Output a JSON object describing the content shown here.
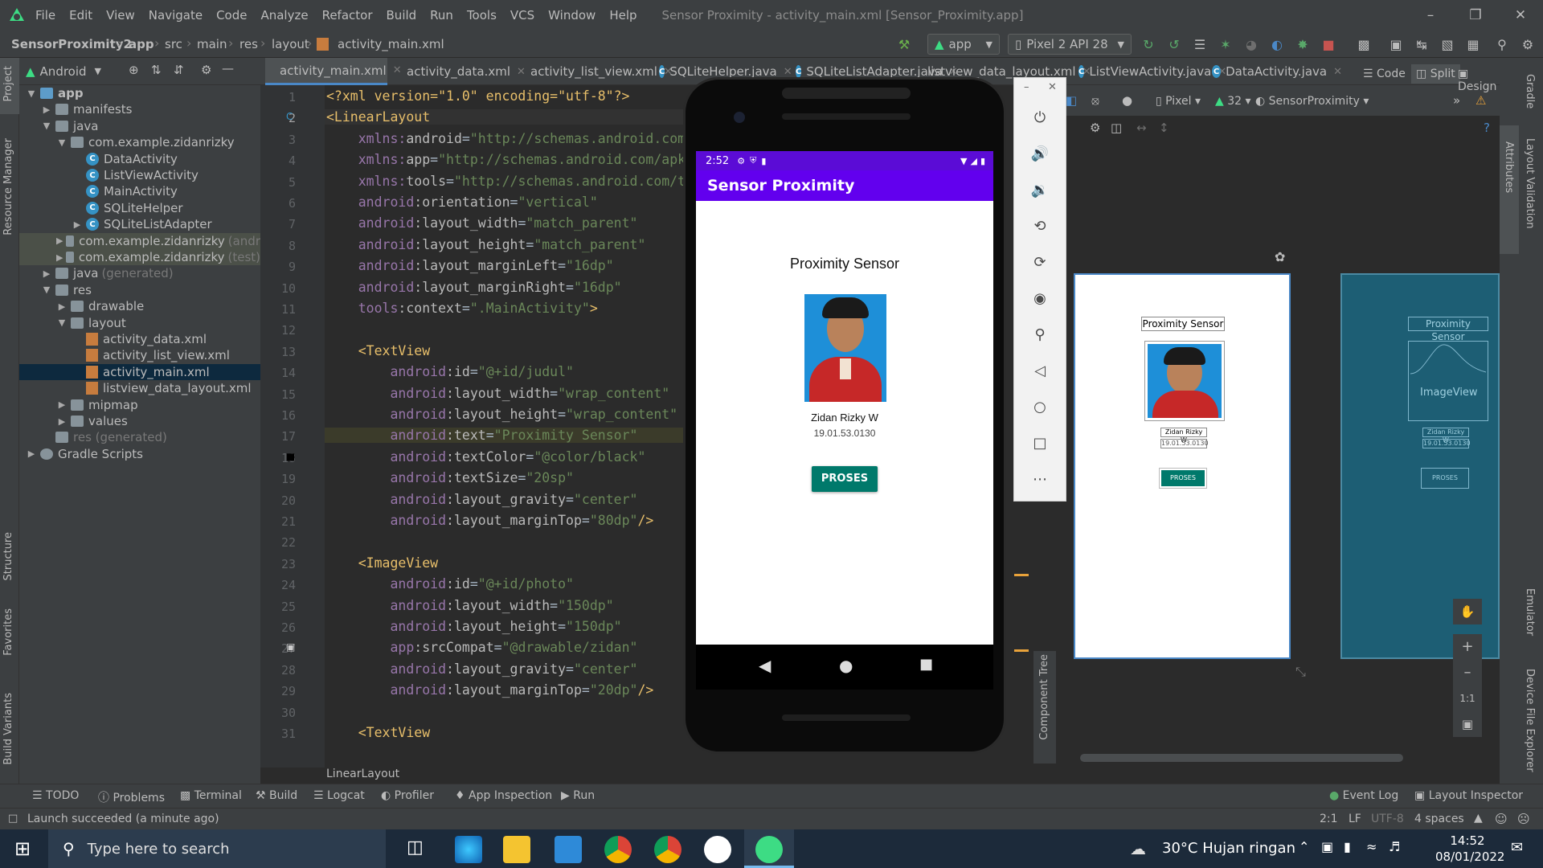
{
  "menu": {
    "items": [
      "File",
      "Edit",
      "View",
      "Navigate",
      "Code",
      "Analyze",
      "Refactor",
      "Build",
      "Run",
      "Tools",
      "VCS",
      "Window",
      "Help"
    ],
    "window_title": "Sensor Proximity - activity_main.xml [Sensor_Proximity.app]"
  },
  "navbar": {
    "breadcrumb": [
      "SensorProximity2",
      "app",
      "src",
      "main",
      "res",
      "layout",
      "activity_main.xml"
    ],
    "run_config": "app",
    "device": "Pixel 2 API 28"
  },
  "project_panel": {
    "view_mode": "Android",
    "tree": [
      {
        "label": "app",
        "level": 0,
        "type": "module",
        "expanded": true
      },
      {
        "label": "manifests",
        "level": 1,
        "type": "folder",
        "expanded": false
      },
      {
        "label": "java",
        "level": 1,
        "type": "folder",
        "expanded": true
      },
      {
        "label": "com.example.zidanrizky",
        "level": 2,
        "type": "package",
        "expanded": true
      },
      {
        "label": "DataActivity",
        "level": 3,
        "type": "class"
      },
      {
        "label": "ListViewActivity",
        "level": 3,
        "type": "class"
      },
      {
        "label": "MainActivity",
        "level": 3,
        "type": "class"
      },
      {
        "label": "SQLiteHelper",
        "level": 3,
        "type": "class"
      },
      {
        "label": "SQLiteListAdapter",
        "level": 3,
        "type": "class",
        "expandable": true
      },
      {
        "label": "com.example.zidanrizky",
        "suffix": "(andr",
        "level": 2,
        "type": "package",
        "highlight": true
      },
      {
        "label": "com.example.zidanrizky",
        "suffix": "(test)",
        "level": 2,
        "type": "package",
        "highlight": true
      },
      {
        "label": "java",
        "suffix": "(generated)",
        "level": 1,
        "type": "folder"
      },
      {
        "label": "res",
        "level": 1,
        "type": "folder",
        "expanded": true
      },
      {
        "label": "drawable",
        "level": 2,
        "type": "folder"
      },
      {
        "label": "layout",
        "level": 2,
        "type": "folder",
        "expanded": true
      },
      {
        "label": "activity_data.xml",
        "level": 3,
        "type": "xml"
      },
      {
        "label": "activity_list_view.xml",
        "level": 3,
        "type": "xml"
      },
      {
        "label": "activity_main.xml",
        "level": 3,
        "type": "xml",
        "selected": true
      },
      {
        "label": "listview_data_layout.xml",
        "level": 3,
        "type": "xml"
      },
      {
        "label": "mipmap",
        "level": 2,
        "type": "folder"
      },
      {
        "label": "values",
        "level": 2,
        "type": "folder"
      },
      {
        "label": "res (generated)",
        "level": 1,
        "type": "folder",
        "dim": true
      },
      {
        "label": "Gradle Scripts",
        "level": 0,
        "type": "gradle"
      }
    ]
  },
  "left_strip": [
    "Project",
    "Resource Manager",
    "Structure",
    "Favorites",
    "Build Variants"
  ],
  "right_strip": [
    "Gradle",
    "Attributes",
    "Layout Validation",
    "Emulator",
    "Device File Explorer"
  ],
  "editor_tabs": [
    {
      "label": "activity_main.xml",
      "active": true
    },
    {
      "label": "activity_data.xml"
    },
    {
      "label": "activity_list_view.xml"
    },
    {
      "label": "SQLiteHelper.java"
    },
    {
      "label": "SQLiteListAdapter.java"
    },
    {
      "label": "listview_data_layout.xml"
    },
    {
      "label": "ListViewActivity.java"
    },
    {
      "label": "DataActivity.java"
    }
  ],
  "code_lines": [
    [
      [
        "t-tag",
        "<?xml version=\"1.0\" encoding=\"utf-8\"?>"
      ]
    ],
    [
      [
        "t-tag",
        "<LinearLayout"
      ]
    ],
    [
      [
        "t-plain",
        "    "
      ],
      [
        "t-ns",
        "xmlns:"
      ],
      [
        "t-attr",
        "android"
      ],
      [
        "t-plain",
        "="
      ],
      [
        "t-val",
        "\"http://schemas.android.com"
      ]
    ],
    [
      [
        "t-plain",
        "    "
      ],
      [
        "t-ns",
        "xmlns:"
      ],
      [
        "t-attr",
        "app"
      ],
      [
        "t-plain",
        "="
      ],
      [
        "t-val",
        "\"http://schemas.android.com/apk"
      ]
    ],
    [
      [
        "t-plain",
        "    "
      ],
      [
        "t-ns",
        "xmlns:"
      ],
      [
        "t-attr",
        "tools"
      ],
      [
        "t-plain",
        "="
      ],
      [
        "t-val",
        "\"http://schemas.android.com/t"
      ]
    ],
    [
      [
        "t-plain",
        "    "
      ],
      [
        "t-ns",
        "android"
      ],
      [
        "t-attr",
        ":orientation"
      ],
      [
        "t-plain",
        "="
      ],
      [
        "t-val",
        "\"vertical\""
      ]
    ],
    [
      [
        "t-plain",
        "    "
      ],
      [
        "t-ns",
        "android"
      ],
      [
        "t-attr",
        ":layout_width"
      ],
      [
        "t-plain",
        "="
      ],
      [
        "t-val",
        "\"match_parent\""
      ]
    ],
    [
      [
        "t-plain",
        "    "
      ],
      [
        "t-ns",
        "android"
      ],
      [
        "t-attr",
        ":layout_height"
      ],
      [
        "t-plain",
        "="
      ],
      [
        "t-val",
        "\"match_parent\""
      ]
    ],
    [
      [
        "t-plain",
        "    "
      ],
      [
        "t-ns",
        "android"
      ],
      [
        "t-attr",
        ":layout_marginLeft"
      ],
      [
        "t-plain",
        "="
      ],
      [
        "t-val",
        "\"16dp\""
      ]
    ],
    [
      [
        "t-plain",
        "    "
      ],
      [
        "t-ns",
        "android"
      ],
      [
        "t-attr",
        ":layout_marginRight"
      ],
      [
        "t-plain",
        "="
      ],
      [
        "t-val",
        "\"16dp\""
      ]
    ],
    [
      [
        "t-plain",
        "    "
      ],
      [
        "t-ns",
        "tools"
      ],
      [
        "t-attr",
        ":context"
      ],
      [
        "t-plain",
        "="
      ],
      [
        "t-val",
        "\".MainActivity\""
      ],
      [
        "t-tag",
        ">"
      ]
    ],
    [
      [
        "t-plain",
        ""
      ]
    ],
    [
      [
        "t-plain",
        "    "
      ],
      [
        "t-tag",
        "<TextView"
      ]
    ],
    [
      [
        "t-plain",
        "        "
      ],
      [
        "t-ns",
        "android"
      ],
      [
        "t-attr",
        ":id"
      ],
      [
        "t-plain",
        "="
      ],
      [
        "t-val",
        "\"@+id/judul\""
      ]
    ],
    [
      [
        "t-plain",
        "        "
      ],
      [
        "t-ns",
        "android"
      ],
      [
        "t-attr",
        ":layout_width"
      ],
      [
        "t-plain",
        "="
      ],
      [
        "t-val",
        "\"wrap_content\""
      ]
    ],
    [
      [
        "t-plain",
        "        "
      ],
      [
        "t-ns",
        "android"
      ],
      [
        "t-attr",
        ":layout_height"
      ],
      [
        "t-plain",
        "="
      ],
      [
        "t-val",
        "\"wrap_content\""
      ]
    ],
    [
      [
        "t-plain",
        "        "
      ],
      [
        "t-ns",
        "android"
      ],
      [
        "t-attr",
        ":text"
      ],
      [
        "t-plain",
        "="
      ],
      [
        "t-val",
        "\"Proximity Sensor\""
      ]
    ],
    [
      [
        "t-plain",
        "        "
      ],
      [
        "t-ns",
        "android"
      ],
      [
        "t-attr",
        ":textColor"
      ],
      [
        "t-plain",
        "="
      ],
      [
        "t-val",
        "\"@color/black\""
      ]
    ],
    [
      [
        "t-plain",
        "        "
      ],
      [
        "t-ns",
        "android"
      ],
      [
        "t-attr",
        ":textSize"
      ],
      [
        "t-plain",
        "="
      ],
      [
        "t-val",
        "\"20sp\""
      ]
    ],
    [
      [
        "t-plain",
        "        "
      ],
      [
        "t-ns",
        "android"
      ],
      [
        "t-attr",
        ":layout_gravity"
      ],
      [
        "t-plain",
        "="
      ],
      [
        "t-val",
        "\"center\""
      ]
    ],
    [
      [
        "t-plain",
        "        "
      ],
      [
        "t-ns",
        "android"
      ],
      [
        "t-attr",
        ":layout_marginTop"
      ],
      [
        "t-plain",
        "="
      ],
      [
        "t-val",
        "\"80dp\""
      ],
      [
        "t-tag",
        "/>"
      ]
    ],
    [
      [
        "t-plain",
        ""
      ]
    ],
    [
      [
        "t-plain",
        "    "
      ],
      [
        "t-tag",
        "<ImageView"
      ]
    ],
    [
      [
        "t-plain",
        "        "
      ],
      [
        "t-ns",
        "android"
      ],
      [
        "t-attr",
        ":id"
      ],
      [
        "t-plain",
        "="
      ],
      [
        "t-val",
        "\"@+id/photo\""
      ]
    ],
    [
      [
        "t-plain",
        "        "
      ],
      [
        "t-ns",
        "android"
      ],
      [
        "t-attr",
        ":layout_width"
      ],
      [
        "t-plain",
        "="
      ],
      [
        "t-val",
        "\"150dp\""
      ]
    ],
    [
      [
        "t-plain",
        "        "
      ],
      [
        "t-ns",
        "android"
      ],
      [
        "t-attr",
        ":layout_height"
      ],
      [
        "t-plain",
        "="
      ],
      [
        "t-val",
        "\"150dp\""
      ]
    ],
    [
      [
        "t-plain",
        "        "
      ],
      [
        "t-ns",
        "app"
      ],
      [
        "t-attr",
        ":srcCompat"
      ],
      [
        "t-plain",
        "="
      ],
      [
        "t-val",
        "\"@drawable/zidan\""
      ]
    ],
    [
      [
        "t-plain",
        "        "
      ],
      [
        "t-ns",
        "android"
      ],
      [
        "t-attr",
        ":layout_gravity"
      ],
      [
        "t-plain",
        "="
      ],
      [
        "t-val",
        "\"center\""
      ]
    ],
    [
      [
        "t-plain",
        "        "
      ],
      [
        "t-ns",
        "android"
      ],
      [
        "t-attr",
        ":layout_marginTop"
      ],
      [
        "t-plain",
        "="
      ],
      [
        "t-val",
        "\"20dp\""
      ],
      [
        "t-tag",
        "/>"
      ]
    ],
    [
      [
        "t-plain",
        ""
      ]
    ],
    [
      [
        "t-plain",
        "    "
      ],
      [
        "t-tag",
        "<TextView"
      ]
    ]
  ],
  "editor_breadcrumb": "LinearLayout",
  "design_toolbar": {
    "modes": [
      "Code",
      "Split",
      "Design"
    ],
    "device": "Pixel",
    "api": "32",
    "theme": "SensorProximity"
  },
  "preview": {
    "title": "Proximity Sensor",
    "name": "Zidan Rizky W",
    "nim": "19.01.53.0130",
    "button": "PROSES",
    "blueprint_image_label": "ImageView"
  },
  "component_tree": "Component Tree",
  "emulator": {
    "time": "2:52",
    "app_title": "Sensor Proximity"
  },
  "tool_windows": [
    "TODO",
    "Problems",
    "Terminal",
    "Build",
    "Logcat",
    "Profiler",
    "App Inspection",
    "Run"
  ],
  "tool_windows_right": [
    "Event Log",
    "Layout Inspector"
  ],
  "status": {
    "message": "Launch succeeded (a minute ago)",
    "position": "2:1",
    "line_sep": "LF",
    "encoding": "UTF-8",
    "indent": "4 spaces"
  },
  "taskbar": {
    "search_placeholder": "Type here to search",
    "weather": "30°C  Hujan ringan",
    "time": "14:52",
    "date": "08/01/2022"
  }
}
